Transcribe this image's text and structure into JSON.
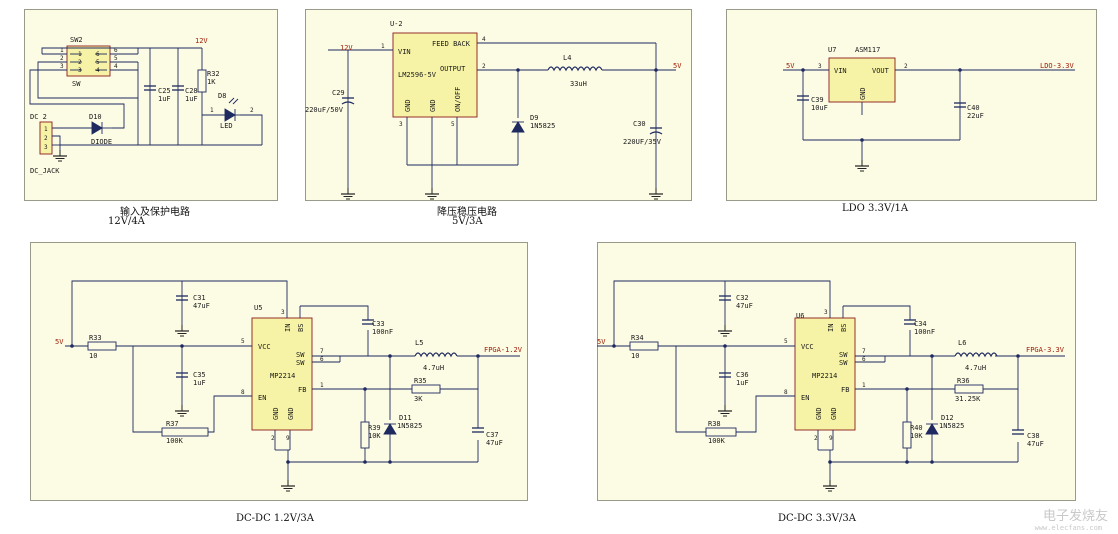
{
  "sections": [
    {
      "caption_lines": [
        "输入及保护电路",
        "12V/4A"
      ]
    },
    {
      "caption_lines": [
        "降压稳压电路",
        "5V/3A"
      ]
    },
    {
      "caption_lines": [
        "LDO 3.3V/1A"
      ]
    },
    {
      "caption_lines": [
        "DC-DC 1.2V/3A"
      ]
    },
    {
      "caption_lines": [
        "DC-DC 3.3V/3A"
      ]
    }
  ],
  "input": {
    "sw_ref": "SW2",
    "sw_name": "SW",
    "pins_left": [
      "1",
      "2",
      "3"
    ],
    "pins_right": [
      "6",
      "5",
      "4"
    ],
    "dc_ref": "DC 2",
    "dc_name": "DC_JACK",
    "dc_pins": [
      "1",
      "2",
      "3"
    ],
    "d10_ref": "D10",
    "d10_val": "DIODE",
    "c25_ref": "C25",
    "c25_val": "1uF",
    "c28_ref": "C28",
    "c28_val": "1uF",
    "r32_ref": "R32",
    "r32_val": "1K",
    "d8_ref": "D8",
    "d8_val": "LED",
    "led_pins": [
      "1",
      "2"
    ],
    "net_12v": "12V"
  },
  "buck5v": {
    "ic_ref": "U-2",
    "ic_name": "LM2596-5V",
    "pin_vin": "VIN",
    "pin_feedback": "FEED BACK",
    "pin_output": "OUTPUT",
    "pin_gnd": "GND",
    "pin_onoff": "ON/OFF",
    "pin_nums": [
      "1",
      "4",
      "2",
      "3",
      "5"
    ],
    "net_in": "12V",
    "net_out": "5V",
    "c29_ref": "C29",
    "c29_val": "220uF/50V",
    "l4_ref": "L4",
    "l4_val": "33uH",
    "d9_ref": "D9",
    "d9_val": "1N5825",
    "c30_ref": "C30",
    "c30_val": "220UF/35V"
  },
  "ldo": {
    "ic_ref": "U7",
    "ic_name": "ASM117",
    "pin_vin": "VIN",
    "pin_vout": "VOUT",
    "pin_gnd": "GND",
    "pin_nums": [
      "3",
      "2"
    ],
    "net_in": "5V",
    "net_out": "LDO-3.3V",
    "c39_ref": "C39",
    "c39_val": "10uF",
    "c40_ref": "C40",
    "c40_val": "22uF"
  },
  "dcdc12": {
    "ic_ref": "U5",
    "ic_name": "MP2214",
    "pins": {
      "in": "IN",
      "bs": "BS",
      "vcc": "VCC",
      "sw": "SW",
      "en": "EN",
      "fb": "FB",
      "gnd": "GND"
    },
    "pin_nums": [
      "3",
      "7",
      "5",
      "6",
      "1",
      "8",
      "2",
      "9"
    ],
    "net_in": "5V",
    "net_out": "FPGA-1.2V",
    "c31_ref": "C31",
    "c31_val": "47uF",
    "r33_ref": "R33",
    "r33_val": "10",
    "c35_ref": "C35",
    "c35_val": "1uF",
    "r37_ref": "R37",
    "r37_val": "100K",
    "c33_ref": "C33",
    "c33_val": "100nF",
    "l5_ref": "L5",
    "l5_val": "4.7uH",
    "r35_ref": "R35",
    "r35_val": "3K",
    "r39_ref": "R39",
    "r39_val": "10K",
    "d11_ref": "D11",
    "d11_val": "1N5825",
    "c37_ref": "C37",
    "c37_val": "47uF"
  },
  "dcdc33": {
    "ic_ref": "U6",
    "ic_name": "MP2214",
    "pins": {
      "in": "IN",
      "bs": "BS",
      "vcc": "VCC",
      "sw": "SW",
      "en": "EN",
      "fb": "FB",
      "gnd": "GND"
    },
    "pin_nums": [
      "3",
      "7",
      "5",
      "6",
      "1",
      "8",
      "2",
      "9"
    ],
    "net_in": "5V",
    "net_out": "FPGA-3.3V",
    "c32_ref": "C32",
    "c32_val": "47uF",
    "r34_ref": "R34",
    "r34_val": "10",
    "c36_ref": "C36",
    "c36_val": "1uF",
    "r38_ref": "R38",
    "r38_val": "100K",
    "c34_ref": "C34",
    "c34_val": "100nF",
    "l6_ref": "L6",
    "l6_val": "4.7uH",
    "r36_ref": "R36",
    "r36_val": "31.25K",
    "r40_ref": "R40",
    "r40_val": "10K",
    "d12_ref": "D12",
    "d12_val": "1N5825",
    "c38_ref": "C38",
    "c38_val": "47uF"
  },
  "watermark": {
    "title": "电子发烧友",
    "url": "www.elecfans.com"
  },
  "colors": {
    "panel": "#fcfbe4",
    "wire": "#1e2a60",
    "net_label": "#a0200a",
    "component": "#1a1a1a"
  }
}
